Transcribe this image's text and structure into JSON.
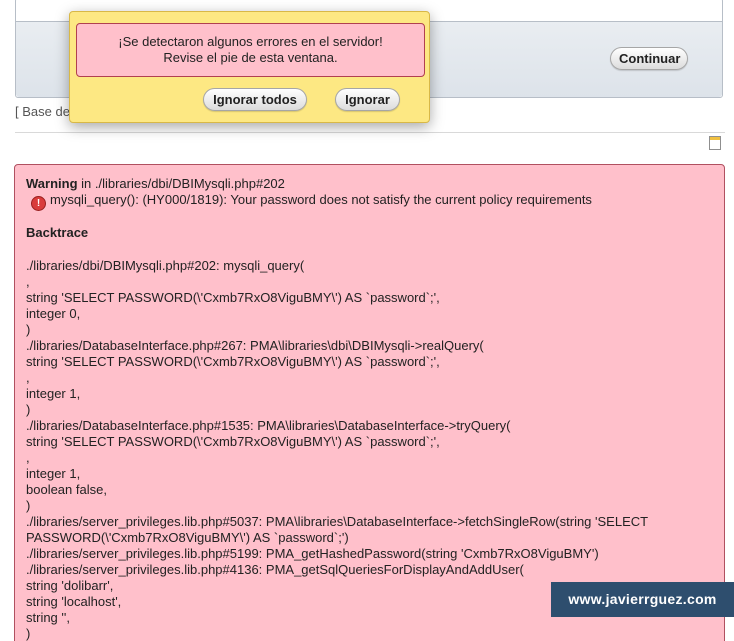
{
  "top_panel": {
    "continue_label": "Continuar"
  },
  "base_text": "[ Base de",
  "popup": {
    "message_line1": "¡Se detectaron algunos errores en el servidor!",
    "message_line2": "Revise el pie de esta ventana.",
    "ignore_all_label": "Ignorar todos",
    "ignore_label": "Ignorar"
  },
  "error": {
    "warning_label": "Warning",
    "warning_location": " in ./libraries/dbi/DBIMysqli.php#202",
    "warning_icon": "error-icon",
    "warning_message": "mysqli_query(): (HY000/1819): Your password does not satisfy the current policy requirements",
    "backtrace_title": "Backtrace",
    "lines": [
      "./libraries/dbi/DBIMysqli.php#202: mysqli_query(",
      ",",
      "string 'SELECT PASSWORD(\\'Cxmb7RxO8ViguBMY\\') AS `password`;',",
      "integer 0,",
      ")",
      "./libraries/DatabaseInterface.php#267: PMA\\libraries\\dbi\\DBIMysqli->realQuery(",
      "string 'SELECT PASSWORD(\\'Cxmb7RxO8ViguBMY\\') AS `password`;',",
      ",",
      "integer 1,",
      ")",
      "./libraries/DatabaseInterface.php#1535: PMA\\libraries\\DatabaseInterface->tryQuery(",
      "string 'SELECT PASSWORD(\\'Cxmb7RxO8ViguBMY\\') AS `password`;',",
      ",",
      "integer 1,",
      "boolean false,",
      ")",
      "./libraries/server_privileges.lib.php#5037: PMA\\libraries\\DatabaseInterface->fetchSingleRow(string 'SELECT",
      "PASSWORD(\\'Cxmb7RxO8ViguBMY\\') AS `password`;')",
      "./libraries/server_privileges.lib.php#5199: PMA_getHashedPassword(string 'Cxmb7RxO8ViguBMY')",
      "./libraries/server_privileges.lib.php#4136: PMA_getSqlQueriesForDisplayAndAddUser(",
      "string 'dolibarr',",
      "string 'localhost',",
      "string '',",
      ")"
    ]
  },
  "watermark": "www.javierrguez.com",
  "colors": {
    "error_bg": "#ffc0cb",
    "popup_bg": "#fde883",
    "watermark_bg": "#2e4e6e"
  }
}
